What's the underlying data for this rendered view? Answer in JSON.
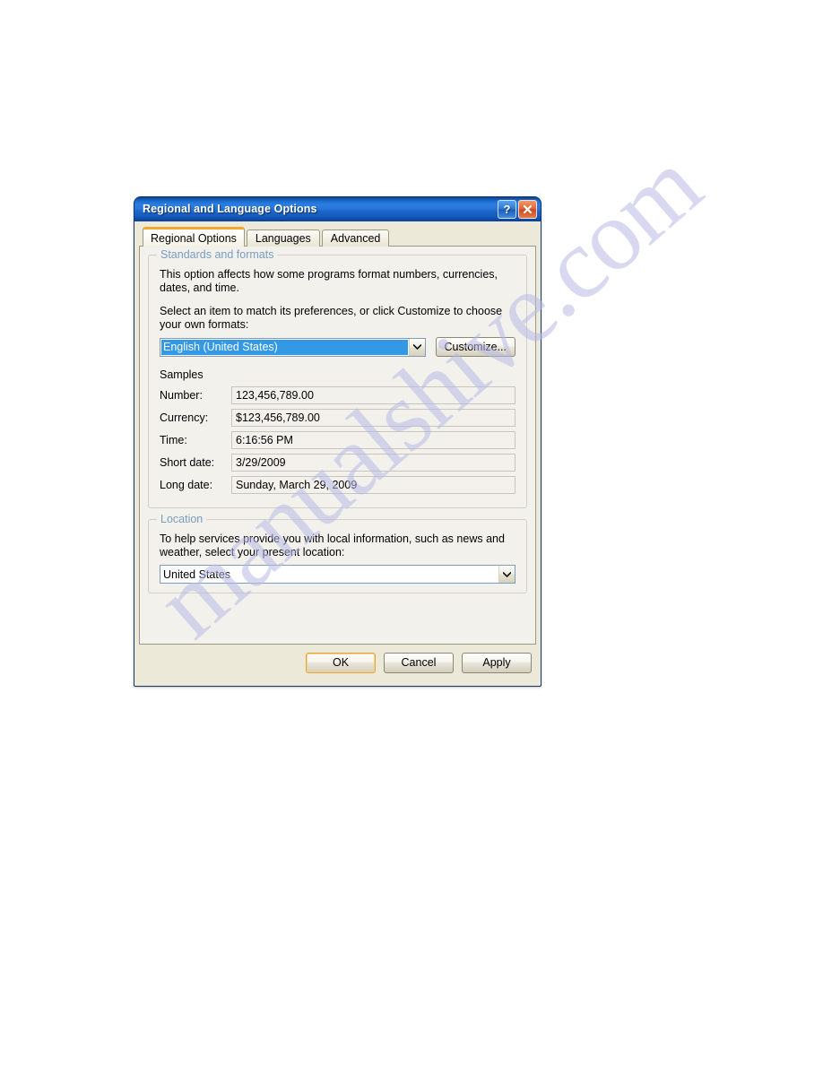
{
  "watermark": {
    "text": "manualshive.com"
  },
  "window": {
    "title": "Regional and Language Options",
    "help_label": "?",
    "close_label": "x",
    "help_icon": "question-mark-icon",
    "close_icon": "close-x-icon"
  },
  "tabs": [
    {
      "label": "Regional Options",
      "active": true
    },
    {
      "label": "Languages",
      "active": false
    },
    {
      "label": "Advanced",
      "active": false
    }
  ],
  "standards_group": {
    "legend": "Standards and formats",
    "description": "This option affects how some programs format numbers, currencies, dates, and time.",
    "instruction": "Select an item to match its preferences, or click Customize to choose your own formats:",
    "locale_value": "English (United States)",
    "customize_label": "Customize...",
    "samples_label": "Samples",
    "samples": [
      {
        "label": "Number:",
        "value": "123,456,789.00"
      },
      {
        "label": "Currency:",
        "value": "$123,456,789.00"
      },
      {
        "label": "Time:",
        "value": "6:16:56 PM"
      },
      {
        "label": "Short date:",
        "value": "3/29/2009"
      },
      {
        "label": "Long date:",
        "value": "Sunday, March 29, 2009"
      }
    ]
  },
  "location_group": {
    "legend": "Location",
    "description": "To help services provide you with local information, such as news and weather, select your present location:",
    "location_value": "United States"
  },
  "footer": {
    "ok_label": "OK",
    "cancel_label": "Cancel",
    "apply_label": "Apply"
  },
  "colors": {
    "titlebar_blue": "#2a7fe0",
    "selection_blue": "#3399e5",
    "legend_blue": "#7a9cc0",
    "default_button_orange": "#e9a33a",
    "active_tab_orange": "#f0a830",
    "close_button_red": "#cf4a1d",
    "watermark_purple": "#b9bbe6"
  }
}
